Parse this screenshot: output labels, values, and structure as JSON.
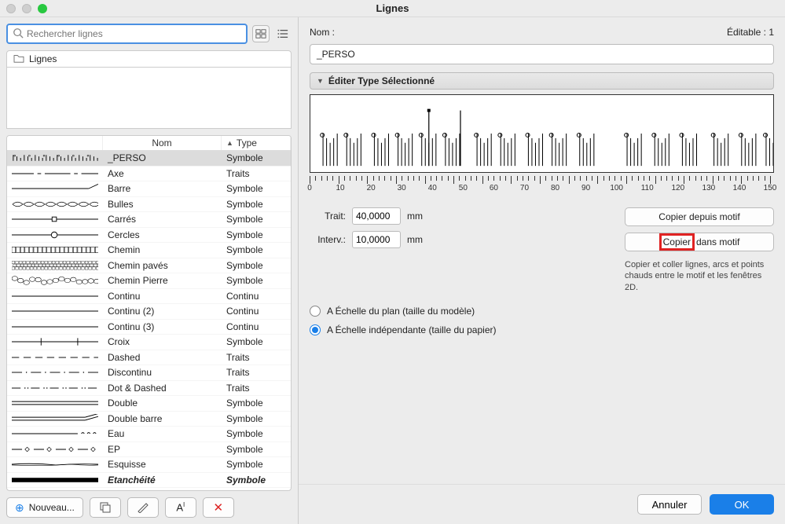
{
  "window": {
    "title": "Lignes"
  },
  "search": {
    "placeholder": "Rechercher lignes"
  },
  "sidebar": {
    "root_label": "Lignes"
  },
  "table": {
    "headers": {
      "nom": "Nom",
      "type": "Type"
    },
    "rows": [
      {
        "nom": "_PERSO",
        "type": "Symbole",
        "style": "perso",
        "selected": true
      },
      {
        "nom": "Axe",
        "type": "Traits",
        "style": "axe"
      },
      {
        "nom": "Barre",
        "type": "Symbole",
        "style": "barre"
      },
      {
        "nom": "Bulles",
        "type": "Symbole",
        "style": "bulles"
      },
      {
        "nom": "Carrés",
        "type": "Symbole",
        "style": "carres"
      },
      {
        "nom": "Cercles",
        "type": "Symbole",
        "style": "cercles"
      },
      {
        "nom": "Chemin",
        "type": "Symbole",
        "style": "chemin"
      },
      {
        "nom": "Chemin pavés",
        "type": "Symbole",
        "style": "chemin-paves"
      },
      {
        "nom": "Chemin Pierre",
        "type": "Symbole",
        "style": "chemin-pierre"
      },
      {
        "nom": "Continu",
        "type": "Continu",
        "style": "continu"
      },
      {
        "nom": "Continu (2)",
        "type": "Continu",
        "style": "continu"
      },
      {
        "nom": "Continu (3)",
        "type": "Continu",
        "style": "continu"
      },
      {
        "nom": "Croix",
        "type": "Symbole",
        "style": "croix"
      },
      {
        "nom": "Dashed",
        "type": "Traits",
        "style": "dashed"
      },
      {
        "nom": "Discontinu",
        "type": "Traits",
        "style": "discontinu"
      },
      {
        "nom": "Dot & Dashed",
        "type": "Traits",
        "style": "dot-dashed"
      },
      {
        "nom": "Double",
        "type": "Symbole",
        "style": "double"
      },
      {
        "nom": "Double barre",
        "type": "Symbole",
        "style": "double-barre"
      },
      {
        "nom": "Eau",
        "type": "Symbole",
        "style": "eau"
      },
      {
        "nom": "EP",
        "type": "Symbole",
        "style": "ep"
      },
      {
        "nom": "Esquisse",
        "type": "Symbole",
        "style": "esquisse"
      },
      {
        "nom": "Etanchéité",
        "type": "Symbole",
        "style": "etancheite",
        "italic": true
      }
    ]
  },
  "toolbar": {
    "nouveau": "Nouveau..."
  },
  "right": {
    "nom_label": "Nom :",
    "editable_label": "Éditable : 1",
    "name_value": "_PERSO",
    "section_title": "Éditer Type Sélectionné",
    "trait_label": "Trait:",
    "trait_value": "40,0000",
    "interv_label": "Interv.:",
    "interv_value": "10,0000",
    "unit": "mm",
    "copy_from": "Copier depuis motif",
    "copy_to_prefix": "Copier",
    "copy_to_suffix": "dans motif",
    "info_text": "Copier et coller lignes, arcs et points chauds entre le motif et les fenêtres 2D.",
    "radio1": "A Échelle du plan (taille du modèle)",
    "radio2": "A Échelle indépendante (taille du papier)",
    "cancel": "Annuler",
    "ok": "OK"
  },
  "ruler": {
    "ticks": [
      0,
      10,
      20,
      30,
      40,
      50,
      60,
      70,
      80,
      90,
      100,
      110,
      120,
      130,
      140,
      150
    ]
  }
}
